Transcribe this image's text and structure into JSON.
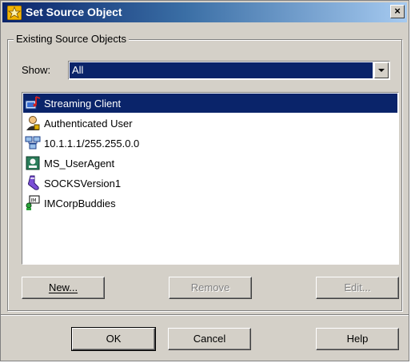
{
  "window": {
    "title": "Set Source Object",
    "close_glyph": "×",
    "title_icon": "gear-star-icon"
  },
  "group": {
    "legend": "Existing Source Objects"
  },
  "show": {
    "label": "Show:",
    "selected_value": "All"
  },
  "list": {
    "items": [
      {
        "label": "Streaming Client",
        "icon": "streaming-client-icon",
        "selected": true
      },
      {
        "label": "Authenticated User",
        "icon": "authenticated-user-icon",
        "selected": false
      },
      {
        "label": "10.1.1.1/255.255.0.0",
        "icon": "network-icon",
        "selected": false
      },
      {
        "label": "MS_UserAgent",
        "icon": "user-agent-icon",
        "selected": false
      },
      {
        "label": "SOCKSVersion1",
        "icon": "socks-icon",
        "selected": false
      },
      {
        "label": "IMCorpBuddies",
        "icon": "im-buddies-icon",
        "selected": false
      }
    ]
  },
  "buttons": {
    "new": "New...",
    "remove": "Remove",
    "edit": "Edit...",
    "ok": "OK",
    "cancel": "Cancel",
    "help": "Help"
  },
  "colors": {
    "selection": "#0a246a",
    "dialog_bg": "#d4d0c8"
  }
}
